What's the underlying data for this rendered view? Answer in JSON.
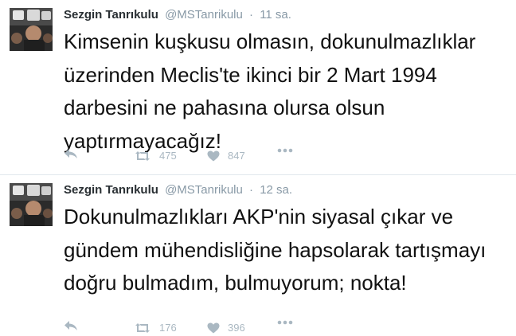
{
  "tweets": [
    {
      "author_name": "Sezgin Tanrıkulu",
      "author_handle": "@MSTanrikulu",
      "separator": "·",
      "time": "11 sa.",
      "text": "Kimsenin kuşkusu olmasın, dokunulmazlıklar üzerinden Meclis'te ikinci bir 2 Mart 1994 darbesini ne pahasına olursa olsun yaptırmayacağız!",
      "retweet_count": "475",
      "like_count": "847"
    },
    {
      "author_name": "Sezgin Tanrıkulu",
      "author_handle": "@MSTanrikulu",
      "separator": "·",
      "time": "12 sa.",
      "text": "Dokunulmazlıkları AKP'nin siyasal çıkar ve gündem mühendisliğine hapsolarak tartışmayı doğru bulmadım, bulmuyorum; nokta!",
      "retweet_count": "176",
      "like_count": "396"
    }
  ],
  "colors": {
    "name": "#292f33",
    "meta": "#8899a6",
    "action": "#aab8c2",
    "divider": "#e1e8ed"
  },
  "icons": [
    "reply-icon",
    "retweet-icon",
    "heart-icon",
    "more-icon"
  ]
}
